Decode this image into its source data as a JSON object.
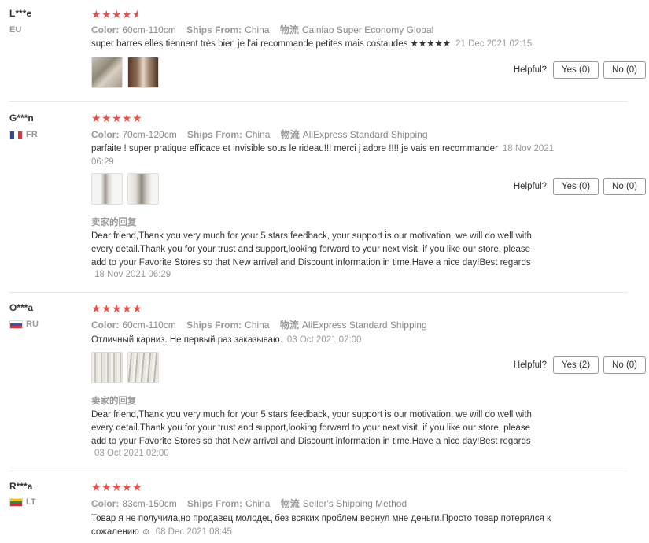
{
  "labels": {
    "color": "Color:",
    "ships_from": "Ships From:",
    "shipping": "物流",
    "helpful": "Helpful?",
    "seller_reply_title": "卖家的回复"
  },
  "star_color": "#e8504b",
  "reviews": [
    {
      "user": "L***e",
      "country": "EU",
      "stars": 4.5,
      "color_value": "60cm-110cm",
      "ships_from_value": "China",
      "shipping_value": "Cainiao Super Economy Global",
      "text": "super barres elles tiennent très bien je l'ai recommande petites mais costaudes ★★★★★",
      "date": "21 Dec 2021 02:15",
      "yes": "Yes (0)",
      "no": "No (0)"
    },
    {
      "user": "G***n",
      "country": "FR",
      "stars": 5,
      "color_value": "70cm-120cm",
      "ships_from_value": "China",
      "shipping_value": "AliExpress Standard Shipping",
      "text": "parfaite ! super pratique efficace et invisible sous le rideau!!! merci j adore !!!! je vais en recommander",
      "date": "18 Nov 2021 06:29",
      "yes": "Yes (0)",
      "no": "No (0)",
      "reply": "Dear friend,Thank you very much for your 5 stars feedback, your support is our motivation, we will do well with every detail.Thank you for your trust and support,looking forward to your next visit. if you like our store, please add to your Favorite Stores so that New arrival and Discount information in time.Have a nice day!Best regards",
      "reply_date": "18 Nov 2021 06:29"
    },
    {
      "user": "O***a",
      "country": "RU",
      "stars": 5,
      "color_value": "60cm-110cm",
      "ships_from_value": "China",
      "shipping_value": "AliExpress Standard Shipping",
      "text": "Отличный карниз. Не первый раз заказываю.",
      "date": "03 Oct 2021 02:00",
      "yes": "Yes (2)",
      "no": "No (0)",
      "reply": "Dear friend,Thank you very much for your 5 stars feedback, your support is our motivation, we will do well with every detail.Thank you for your trust and support,looking forward to your next visit. if you like our store, please add to your Favorite Stores so that New arrival and Discount information in time.Have a nice day!Best regards",
      "reply_date": "03 Oct 2021 02:00"
    },
    {
      "user": "R***a",
      "country": "LT",
      "stars": 5,
      "color_value": "83cm-150cm",
      "ships_from_value": "China",
      "shipping_value": "Seller's Shipping Method",
      "text": "Товар я не получила,но продавец молодец без всяких проблем вернул мне деньги.Просто товар потерялся к сожалению ☺",
      "date": "08 Dec 2021 08:45"
    }
  ]
}
